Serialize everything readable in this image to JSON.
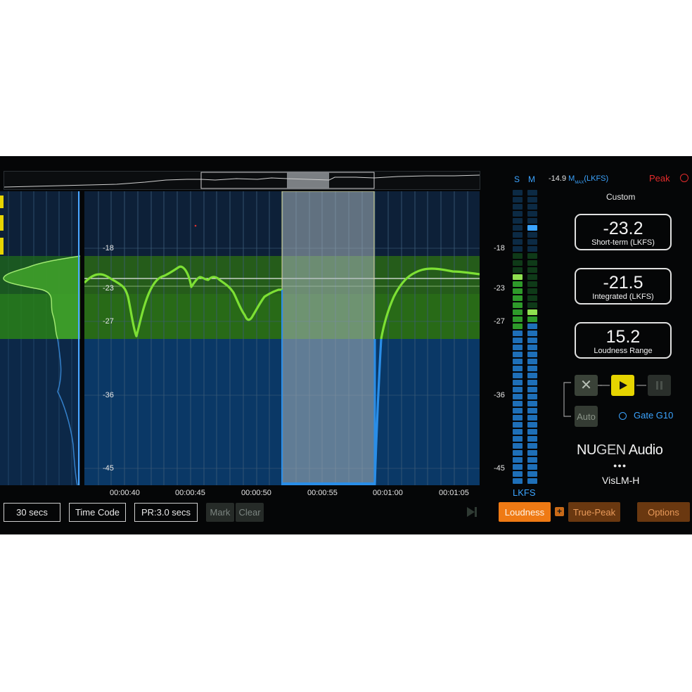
{
  "header": {
    "max_value": "-14.9",
    "max_unit_m": "M",
    "max_sub": "MAX",
    "max_unit": "(LKFS)",
    "peak_label": "Peak",
    "preset": "Custom"
  },
  "meters": {
    "s_label": "S",
    "m_label": "M",
    "unit_label": "LKFS"
  },
  "graph": {
    "ticks": [
      "-18",
      "-23",
      "-27",
      "-36",
      "-45"
    ],
    "times": [
      "00:00:40",
      "00:00:45",
      "00:00:50",
      "00:00:55",
      "00:01:00",
      "00:01:05"
    ]
  },
  "readouts": [
    {
      "value": "-23.2",
      "label": "Short-term (LKFS)"
    },
    {
      "value": "-21.5",
      "label": "Integrated (LKFS)"
    },
    {
      "value": "15.2",
      "label": "Loudness Range"
    }
  ],
  "transport": {
    "auto_label": "Auto",
    "gate_label": "Gate G10"
  },
  "brand": {
    "name_nu": "NU",
    "name_gen": "GEN",
    "name_audio": " Audio",
    "dots": "●●●",
    "product": "VisLM-H"
  },
  "toolbar": {
    "duration": "30 secs",
    "timecode": "Time Code",
    "pr": "PR:3.0 secs",
    "mark": "Mark",
    "clear": "Clear"
  },
  "footer": {
    "loudness": "Loudness",
    "true_peak": "True-Peak",
    "options": "Options"
  },
  "colors": {
    "accent_orange": "#ef7a14",
    "green_curve": "#7de034",
    "blue_curve": "#2a8ee8",
    "background": "#050607",
    "peak_red": "#e32b2b"
  }
}
